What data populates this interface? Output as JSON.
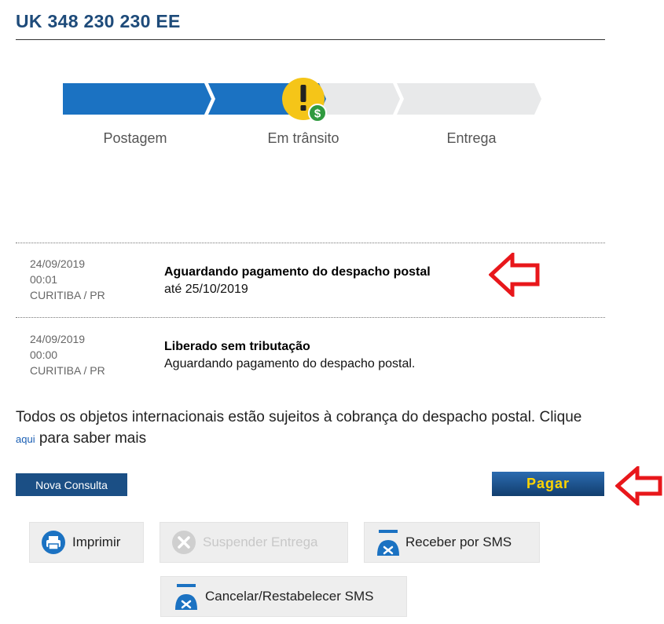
{
  "header": {
    "title": "UK 348 230 230 EE"
  },
  "progress": {
    "steps": [
      {
        "label": "Postagem",
        "state": "done"
      },
      {
        "label": "Em trânsito",
        "state": "current"
      },
      {
        "label": "Entrega",
        "state": "pending"
      }
    ],
    "alert_icon": "exclamation-dollar-icon",
    "colors": {
      "done": "#1b72c2",
      "pending": "#e8e9ea",
      "alert": "#f5c518",
      "dollar": "#2f9a3f"
    }
  },
  "events": [
    {
      "date": "24/09/2019",
      "time": "00:01",
      "location": "CURITIBA / PR",
      "title": "Aguardando pagamento do despacho postal",
      "detail": "até 25/10/2019"
    },
    {
      "date": "24/09/2019",
      "time": "00:00",
      "location": "CURITIBA / PR",
      "title": "Liberado sem tributação",
      "detail": "Aguardando pagamento do despacho postal."
    }
  ],
  "note": {
    "text_before": "Todos os objetos internacionais estão sujeitos à cobrança do despacho postal. Clique ",
    "link": "aqui",
    "text_after": " para saber mais"
  },
  "buttons": {
    "nova_consulta": "Nova Consulta",
    "pagar": "Pagar",
    "imprimir": "Imprimir",
    "suspender": "Suspender Entrega",
    "receber_sms": "Receber por SMS",
    "cancelar_sms": "Cancelar/Restabelecer SMS"
  },
  "annotations": {
    "arrow_color": "#e8171b"
  }
}
